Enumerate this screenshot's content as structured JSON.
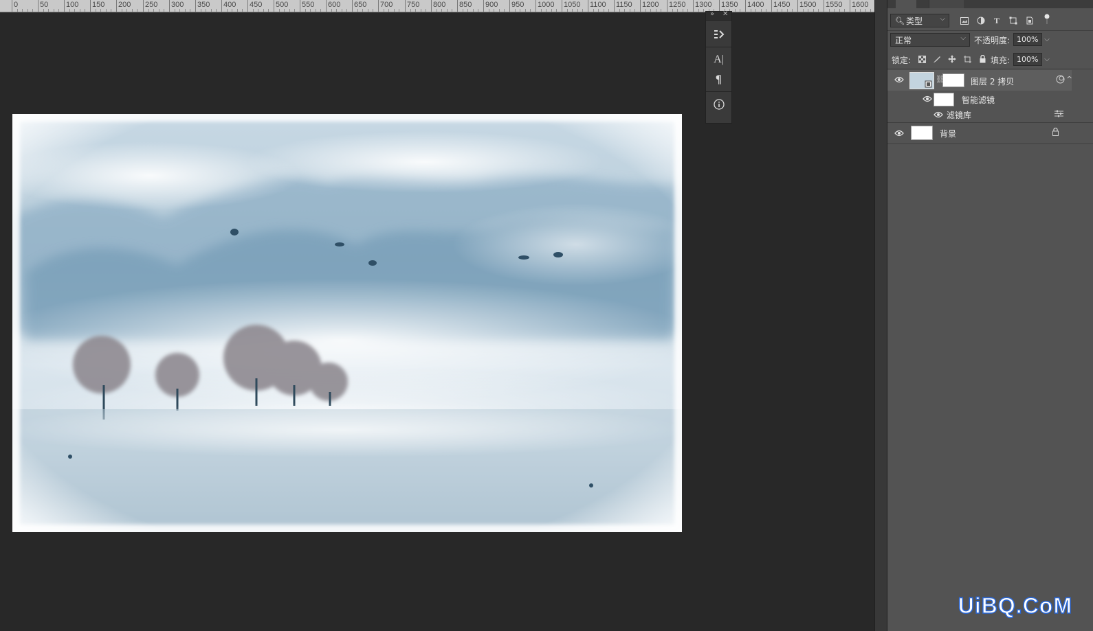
{
  "ruler": {
    "labels": [
      "0",
      "50",
      "100",
      "150",
      "200",
      "250",
      "300",
      "350",
      "400",
      "450",
      "500",
      "550",
      "600",
      "650",
      "700",
      "750",
      "800",
      "850",
      "900",
      "950",
      "1000",
      "1050",
      "1100",
      "1150",
      "1200",
      "1250",
      "1300",
      "1350",
      "1400",
      "1450",
      "1500",
      "1550",
      "1600"
    ]
  },
  "dock": {
    "collapse_icon": "double-chevron-right",
    "close_icon": "close",
    "buttons": [
      {
        "name": "history-icon",
        "glyph": "⌗"
      },
      {
        "name": "character-icon",
        "glyph": "A|"
      },
      {
        "name": "paragraph-icon",
        "glyph": "¶"
      },
      {
        "name": "info-icon",
        "glyph": "ⓘ"
      }
    ]
  },
  "layers_panel": {
    "filter_kind": "类型",
    "blend_mode": "正常",
    "opacity_label": "不透明度:",
    "opacity_value": "100%",
    "lock_label": "锁定:",
    "fill_label": "填充:",
    "fill_value": "100%",
    "layers": [
      {
        "name": "图层 2 拷贝",
        "type": "smart-object"
      },
      {
        "name": "智能滤镜",
        "type": "smart-filter"
      },
      {
        "name": "滤镜库",
        "type": "filter"
      },
      {
        "name": "背景",
        "type": "background",
        "locked": true
      }
    ]
  },
  "watermark": "UiBQ.CoM",
  "colors": {
    "canvas_bg": "#282828",
    "panel_bg": "#535353",
    "selected_row": "#5d5d5d",
    "watermark_stroke": "#2a68d8"
  }
}
